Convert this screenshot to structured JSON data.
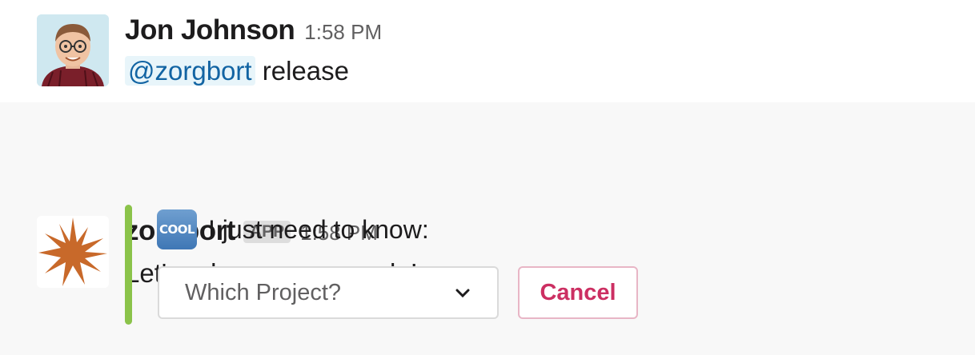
{
  "messages": [
    {
      "sender": "Jon Johnson",
      "time": "1:58 PM",
      "mention": "@zorgbort",
      "text": "release"
    },
    {
      "sender": "zorgbort",
      "badge": "APP",
      "time": "1:58 PM",
      "text": "Let's release some code!",
      "attachment": {
        "icon": "cool-emoji-icon",
        "icon_text": "COOL",
        "text": "I just need to know:",
        "accent_color": "#8bc34a",
        "select_placeholder": "Which Project?",
        "cancel_label": "Cancel"
      }
    }
  ],
  "colors": {
    "mention": "#1264a3",
    "cancel": "#cc2f62",
    "bot_avatar": "#c8692a"
  }
}
